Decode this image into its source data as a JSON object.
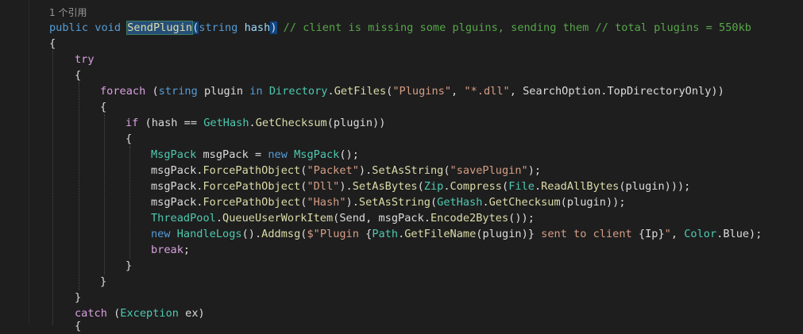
{
  "editor": {
    "codelens": "1 个引用",
    "signature": {
      "kw_public": "public",
      "kw_void": "void",
      "method_name": "SendPlugin",
      "open_paren": "(",
      "kw_string": "string",
      "param_hash": "hash",
      "close_paren": ")",
      "comment": " // client is missing some plguins, sending them // total plugins = 550kb"
    },
    "brace_open_method": "{",
    "kw_try": "try",
    "brace_open_try": "{",
    "foreach_line": {
      "kw_foreach": "foreach",
      "p1": " (",
      "kw_string": "string",
      "p2": " plugin ",
      "kw_in": "in",
      "p3": " ",
      "type_directory": "Directory",
      "p4": ".",
      "method_getfiles": "GetFiles",
      "p5": "(",
      "str_plugins": "\"Plugins\"",
      "p6": ", ",
      "str_pattern": "\"*.dll\"",
      "p7": ", SearchOption.TopDirectoryOnly))"
    },
    "brace_open_foreach": "{",
    "if_line": {
      "kw_if": "if",
      "p1": " (hash == ",
      "type_gethash": "GetHash",
      "p2": ".",
      "method_getchecksum": "GetChecksum",
      "p3": "(plugin))"
    },
    "brace_open_if": "{",
    "line_msgpack": {
      "type1": "MsgPack",
      "p1": " msgPack = ",
      "kw_new": "new",
      "p2": " ",
      "type2": "MsgPack",
      "p3": "();"
    },
    "line_packet": {
      "p1": "msgPack.",
      "m1": "ForcePathObject",
      "p2": "(",
      "s1": "\"Packet\"",
      "p3": ").",
      "m2": "SetAsString",
      "p4": "(",
      "s2": "\"savePlugin\"",
      "p5": ");"
    },
    "line_dll": {
      "p1": "msgPack.",
      "m1": "ForcePathObject",
      "p2": "(",
      "s1": "\"Dll\"",
      "p3": ").",
      "m2": "SetAsBytes",
      "p4": "(",
      "t1": "Zip",
      "p5": ".",
      "m3": "Compress",
      "p6": "(",
      "t2": "File",
      "p7": ".",
      "m4": "ReadAllBytes",
      "p8": "(plugin)));"
    },
    "line_hash": {
      "p1": "msgPack.",
      "m1": "ForcePathObject",
      "p2": "(",
      "s1": "\"Hash\"",
      "p3": ").",
      "m2": "SetAsString",
      "p4": "(",
      "t1": "GetHash",
      "p5": ".",
      "m3": "GetChecksum",
      "p6": "(plugin));"
    },
    "line_threadpool": {
      "t1": "ThreadPool",
      "p1": ".",
      "m1": "QueueUserWorkItem",
      "p2": "(Send, msgPack.",
      "m2": "Encode2Bytes",
      "p3": "());"
    },
    "line_handlelogs": {
      "kw_new": "new",
      "p1": " ",
      "t1": "HandleLogs",
      "p2": "().",
      "m1": "Addmsg",
      "p3": "(",
      "s1": "$\"Plugin ",
      "i1": "{",
      "t2": "Path",
      "i2": ".",
      "m2": "GetFileName",
      "i3": "(plugin)}",
      "s2": " sent to client ",
      "i4": "{Ip}",
      "s3": "\"",
      "p4": ", ",
      "t3": "Color",
      "p5": ".Blue);"
    },
    "line_break": {
      "kw_break": "break",
      "p1": ";"
    },
    "brace_close_if": "}",
    "brace_close_foreach": "}",
    "brace_close_try": "}",
    "catch_line": {
      "kw_catch": "catch",
      "p1": " (",
      "type_exception": "Exception",
      "p2": " ex)"
    },
    "brace_open_catch": "{"
  }
}
